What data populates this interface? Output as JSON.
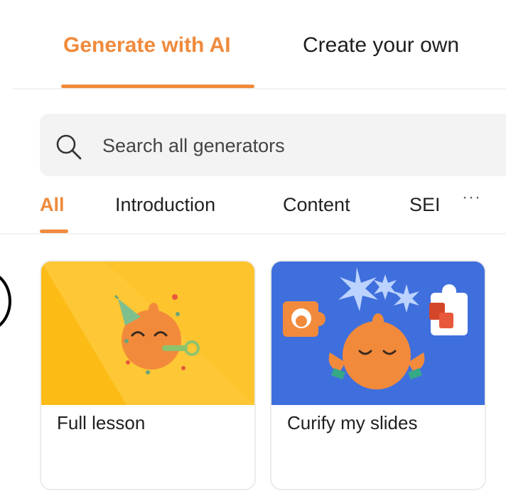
{
  "tabs": {
    "generate_label": "Generate with AI",
    "create_label": "Create your own"
  },
  "search": {
    "placeholder": "Search all generators",
    "value": ""
  },
  "categories": [
    {
      "label": "All",
      "active": true
    },
    {
      "label": "Introduction",
      "active": false
    },
    {
      "label": "Content",
      "active": false
    },
    {
      "label": "SEI",
      "active": false
    }
  ],
  "more_icon": "ellipsis-icon",
  "cards": [
    {
      "title": "Full lesson",
      "image": "party-mascot-illustration"
    },
    {
      "title": "Curify my slides",
      "image": "puzzle-mascot-illustration"
    }
  ],
  "colors": {
    "accent": "#f08a3c",
    "card1_bg": "#fdbb16",
    "card2_bg": "#3f6fdc",
    "mascot": "#f28a3c"
  }
}
